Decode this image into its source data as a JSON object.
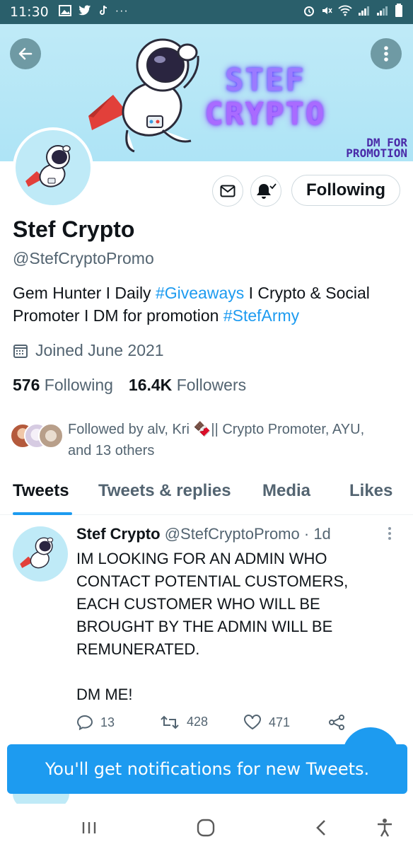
{
  "status_bar": {
    "time": "11:30",
    "left_icons": [
      "image-icon",
      "twitter-icon",
      "tiktok-icon",
      "more-dots-icon"
    ],
    "right_icons": [
      "alarm-icon",
      "mute-icon",
      "wifi-icon",
      "signal-icon",
      "signal-icon",
      "battery-icon"
    ]
  },
  "banner": {
    "title_line1": "STEF",
    "title_line2": "CRYPTO",
    "dm_line1": "DM FOR",
    "dm_line2": "PROMOTION",
    "background_color": "#aee4f6"
  },
  "profile": {
    "name": "Stef Crypto",
    "handle": "@StefCryptoPromo",
    "bio_part1": "Gem Hunter I Daily ",
    "bio_tag1": "#Giveaways",
    "bio_part2": "  I Crypto & Social Promoter I DM for promotion ",
    "bio_tag2": "#StefArmy",
    "joined": "Joined June 2021",
    "following_count": "576",
    "following_label": "Following",
    "followers_count": "16.4K",
    "followers_label": "Followers",
    "followed_by_line1": "Followed by alv, Kri 🍫|| Crypto Promoter, AYU,",
    "followed_by_line2": "and 13 others",
    "following_button": "Following"
  },
  "tabs": [
    {
      "label": "Tweets",
      "active": true
    },
    {
      "label": "Tweets & replies",
      "active": false
    },
    {
      "label": "Media",
      "active": false
    },
    {
      "label": "Likes",
      "active": false
    }
  ],
  "tweet": {
    "author_name": "Stef Crypto",
    "author_handle": "@StefCryptoPromo",
    "time": "· 1d",
    "body": "IM LOOKING FOR AN ADMIN WHO CONTACT POTENTIAL CUSTOMERS, EACH CUSTOMER WHO WILL BE BROUGHT BY THE ADMIN WILL BE REMUNERATED.\n\nDM ME!",
    "replies": "13",
    "retweets": "428",
    "likes": "471"
  },
  "toast": {
    "text": "You'll get notifications for new Tweets."
  },
  "colors": {
    "accent": "#1d9bf0",
    "status_bar": "#2a5f6b",
    "text_secondary": "#536471"
  }
}
